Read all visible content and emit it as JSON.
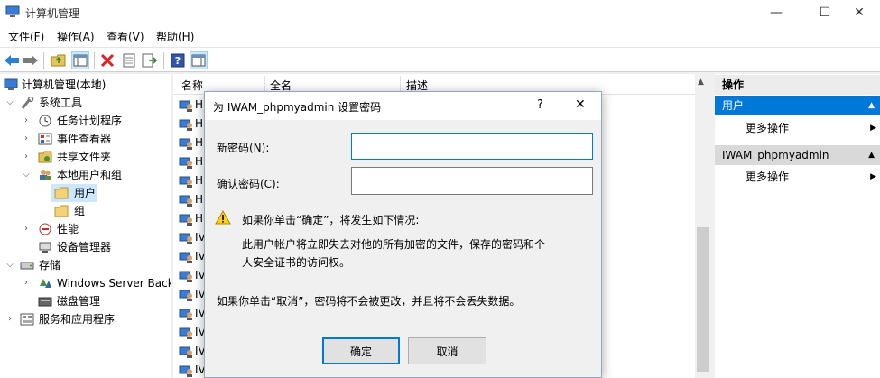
{
  "window": {
    "title": "计算机管理",
    "minimize_glyph": "—",
    "maximize_glyph": "☐",
    "close_glyph": "✕"
  },
  "menu": [
    "文件(F)",
    "操作(A)",
    "查看(V)",
    "帮助(H)"
  ],
  "toolbar": {
    "icons": [
      "back-icon",
      "forward-icon",
      "up-folder-icon",
      "show-hide-tree-icon",
      "delete-icon",
      "properties-icon",
      "export-list-icon",
      "help-icon",
      "show-hide-action-pane-icon"
    ]
  },
  "tree": {
    "root": "计算机管理(本地)",
    "system_tools": "系统工具",
    "task_scheduler": "任务计划程序",
    "event_viewer": "事件查看器",
    "shared_folders": "共享文件夹",
    "local_users_groups": "本地用户和组",
    "users": "用户",
    "groups": "组",
    "performance": "性能",
    "device_manager": "设备管理器",
    "storage": "存储",
    "windows_server_backup": "Windows Server Back",
    "disk_management": "磁盘管理",
    "services_apps": "服务和应用程序"
  },
  "list": {
    "columns": [
      "名称",
      "全名",
      "描述"
    ],
    "rows": [
      "H",
      "H",
      "H",
      "H",
      "H",
      "H",
      "H",
      "IV",
      "IV",
      "IV",
      "IV",
      "IV",
      "IV",
      "IV",
      "IV"
    ]
  },
  "actions": {
    "header": "操作",
    "section1": "用户",
    "more1": "更多操作",
    "section2": "IWAM_phpmyadmin",
    "more2": "更多操作"
  },
  "dialog": {
    "title": "为 IWAM_phpmyadmin 设置密码",
    "help_glyph": "?",
    "close_glyph": "✕",
    "new_password_label": "新密码(N):",
    "confirm_password_label": "确认密码(C):",
    "new_password_value": "",
    "confirm_password_value": "",
    "warning_heading": "如果你单击“确定”，将发生如下情况:",
    "warning_body": "此用户帐户将立即失去对他的所有加密的文件，保存的密码和个人安全证书的访问权。",
    "cancel_note": "如果你单击“取消”，密码将不会被更改，并且将不会丢失数据。",
    "ok_label": "确定",
    "cancel_label": "取消"
  }
}
